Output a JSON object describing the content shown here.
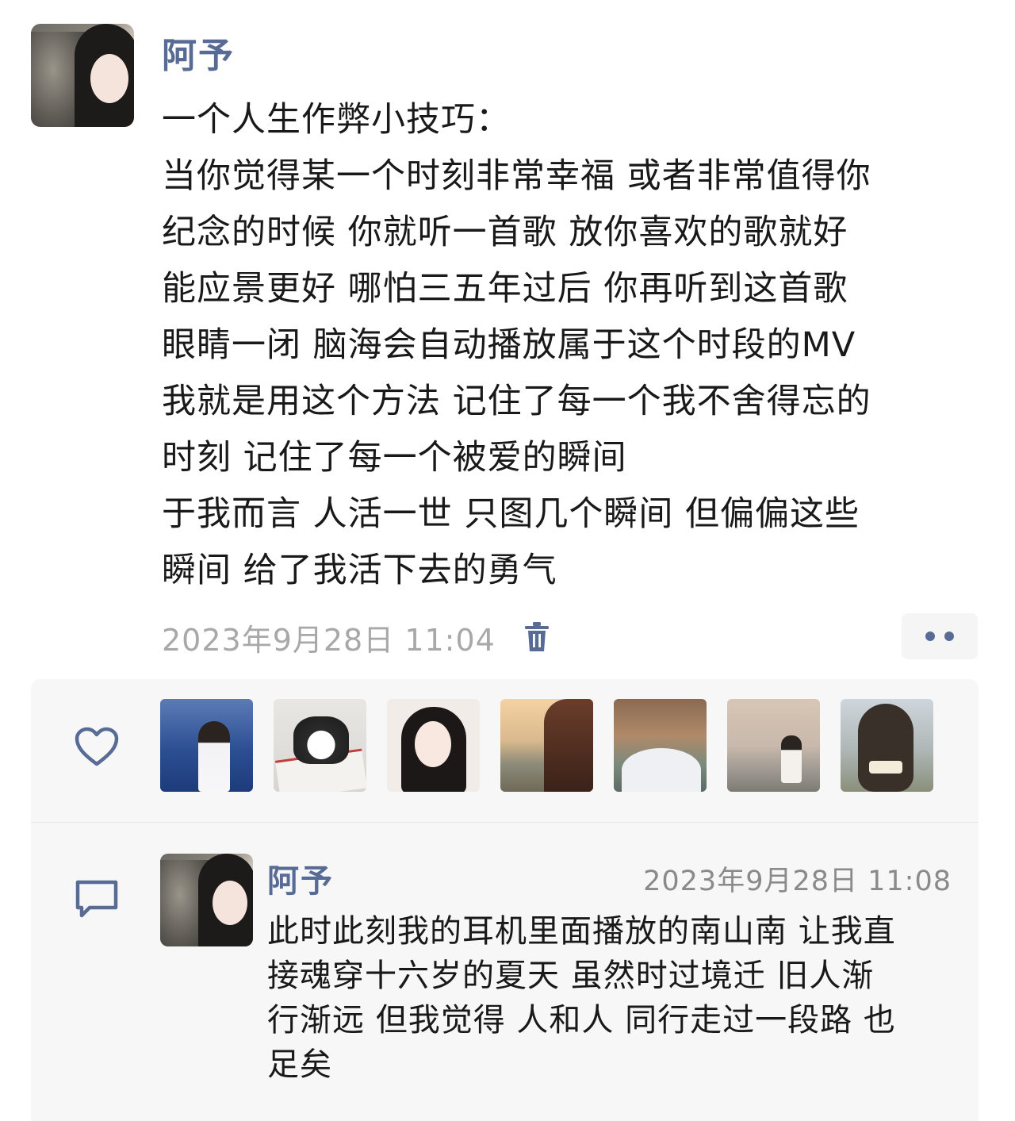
{
  "post": {
    "author": "阿予",
    "content_lines": [
      "一个人生作弊小技巧：",
      "当你觉得某一个时刻非常幸福 或者非常值得你",
      "纪念的时候 你就听一首歌  放你喜欢的歌就好",
      "能应景更好   哪怕三五年过后 你再听到这首歌",
      "眼睛一闭 脑海会自动播放属于这个时段的MV",
      "我就是用这个方法 记住了每一个我不舍得忘的",
      "时刻  记住了每一个被爱的瞬间",
      "于我而言 人活一世 只图几个瞬间 但偏偏这些",
      "瞬间 给了我活下去的勇气"
    ],
    "timestamp": "2023年9月28日 11:04"
  },
  "icons": {
    "trash": "trash-icon",
    "more": "more-dots-icon",
    "like": "heart-outline-icon",
    "comment": "comment-bubble-icon"
  },
  "likes": {
    "count_shown": 7
  },
  "comment": {
    "author": "阿予",
    "timestamp": "2023年9月28日 11:08",
    "lines": [
      "此时此刻我的耳机里面播放的南山南 让我直",
      "接魂穿十六岁的夏天 虽然时过境迁 旧人渐",
      "行渐远 但我觉得 人和人 同行走过一段路 也",
      "足矣"
    ]
  },
  "colors": {
    "link_blue": "#576b95",
    "timestamp_gray": "#a8a8a8",
    "panel_bg": "#f7f7f7"
  }
}
